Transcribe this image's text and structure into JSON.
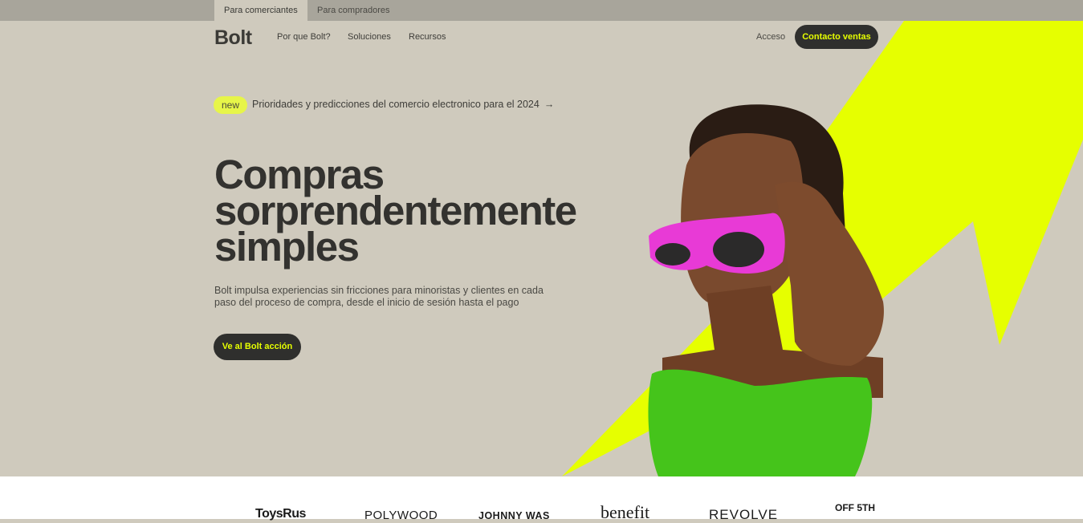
{
  "top_tabs": [
    {
      "label": "Para comerciantes",
      "active": true
    },
    {
      "label": "Para compradores",
      "active": false
    }
  ],
  "nav": {
    "logo": "Bolt",
    "links": [
      "Por que Bolt?",
      "Soluciones",
      "Recursos"
    ],
    "login": "Acceso",
    "contact": "Contacto ventas"
  },
  "announcement": {
    "badge": "new",
    "text": "Prioridades y predicciones del comercio electronico para el 2024",
    "arrow": "→"
  },
  "hero": {
    "headline": [
      "Compras",
      "sorprendentemente",
      "simples"
    ],
    "subtext": "Bolt impulsa experiencias sin fricciones para minoristas y clientes en cada paso del proceso de compra, desde el inicio de sesión hasta el pago",
    "cta": "Ve al Bolt acción"
  },
  "brand_logos": [
    "ToysRus",
    "POLYWOOD",
    "JOHNNY WAS",
    "benefit",
    "REVOLVE",
    "OFF 5TH"
  ],
  "colors": {
    "background": "#cfcabd",
    "accent": "#e6ff00",
    "dark": "#2f2f2d",
    "glasses": "#e83ad6",
    "dress": "#45c41b"
  }
}
